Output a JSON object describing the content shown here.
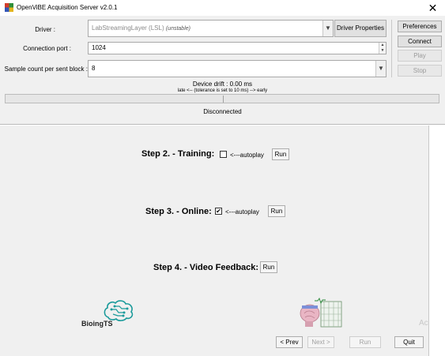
{
  "window": {
    "title": "OpenViBE Acquisition Server v2.0.1",
    "close_glyph": "✕"
  },
  "form": {
    "driver_label": "Driver :",
    "driver_value": "LabStreamingLayer (LSL)",
    "driver_tag": "(unstable)",
    "driver_properties_label": "Driver Properties",
    "port_label": "Connection port :",
    "port_value": "1024",
    "sample_label": "Sample count per sent block :",
    "sample_value": "8"
  },
  "side_buttons": {
    "preferences": "Preferences",
    "connect": "Connect",
    "play": "Play",
    "stop": "Stop"
  },
  "drift": {
    "title": "Device drift : 0.00 ms",
    "tolerance": "late <-- (tolerance is set to 10 ms) --> early"
  },
  "status": "Disconnected",
  "steps": {
    "training": {
      "title": "Step 2. - Training:",
      "autoplay": "<---autoplay",
      "checked": false,
      "run": "Run"
    },
    "online": {
      "title": "Step 3. - Online:",
      "autoplay": "<---autoplay",
      "checked": true,
      "run": "Run"
    },
    "video": {
      "title": "Step 4. - Video Feedback:",
      "run": "Run"
    }
  },
  "logo_text": "BioingTS",
  "nav": {
    "prev": "< Prev",
    "next": "Next >",
    "run": "Run",
    "quit": "Quit"
  },
  "watermark": "Ac",
  "colors": {
    "logo_teal": "#1a9a9a",
    "window_bg": "#f0f0f0"
  },
  "icons": {
    "app": "openvibe-cube-icon",
    "close": "close-icon",
    "dropdown": "chevron-down-icon",
    "spinner": "spinner-arrows-icon",
    "logo": "brain-circuit-logo",
    "feedback": "brain-feedback-image"
  }
}
